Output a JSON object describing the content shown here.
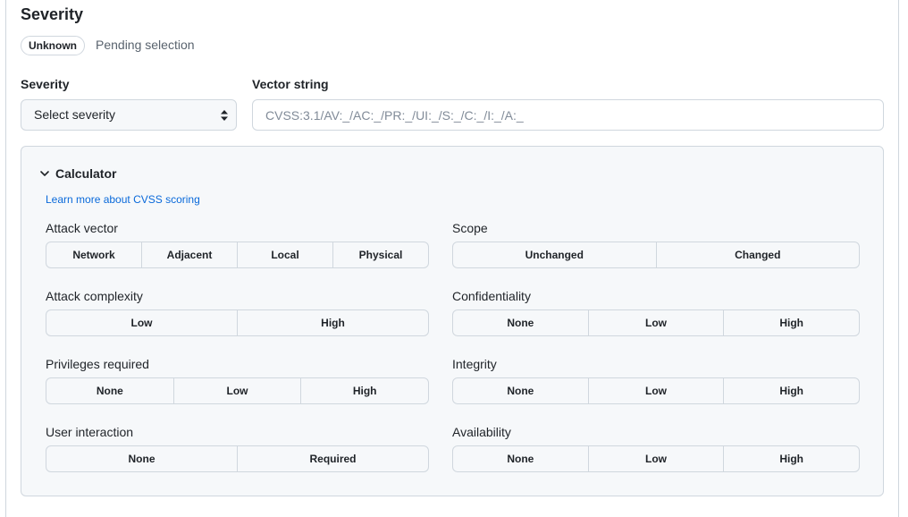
{
  "section": {
    "title": "Severity",
    "badge": "Unknown",
    "status": "Pending selection"
  },
  "severity_field": {
    "label": "Severity",
    "selected": "Select severity"
  },
  "vector_field": {
    "label": "Vector string",
    "placeholder": "CVSS:3.1/AV:_/AC:_/PR:_/UI:_/S:_/C:_/I:_/A:_"
  },
  "calculator": {
    "toggle_label": "Calculator",
    "learn_link": "Learn more about CVSS scoring",
    "metrics": {
      "attack_vector": {
        "label": "Attack vector",
        "options": [
          "Network",
          "Adjacent",
          "Local",
          "Physical"
        ]
      },
      "attack_complexity": {
        "label": "Attack complexity",
        "options": [
          "Low",
          "High"
        ]
      },
      "privileges_required": {
        "label": "Privileges required",
        "options": [
          "None",
          "Low",
          "High"
        ]
      },
      "user_interaction": {
        "label": "User interaction",
        "options": [
          "None",
          "Required"
        ]
      },
      "scope": {
        "label": "Scope",
        "options": [
          "Unchanged",
          "Changed"
        ]
      },
      "confidentiality": {
        "label": "Confidentiality",
        "options": [
          "None",
          "Low",
          "High"
        ]
      },
      "integrity": {
        "label": "Integrity",
        "options": [
          "None",
          "Low",
          "High"
        ]
      },
      "availability": {
        "label": "Availability",
        "options": [
          "None",
          "Low",
          "High"
        ]
      }
    }
  },
  "icons": {
    "select_arrows": "select-arrows-icon",
    "calculator_chevron": "chevron-down-icon"
  },
  "colors": {
    "link": "#0969da",
    "border": "#d0d7de",
    "panel_bg": "#f6f8fa",
    "muted_text": "#59636e"
  }
}
